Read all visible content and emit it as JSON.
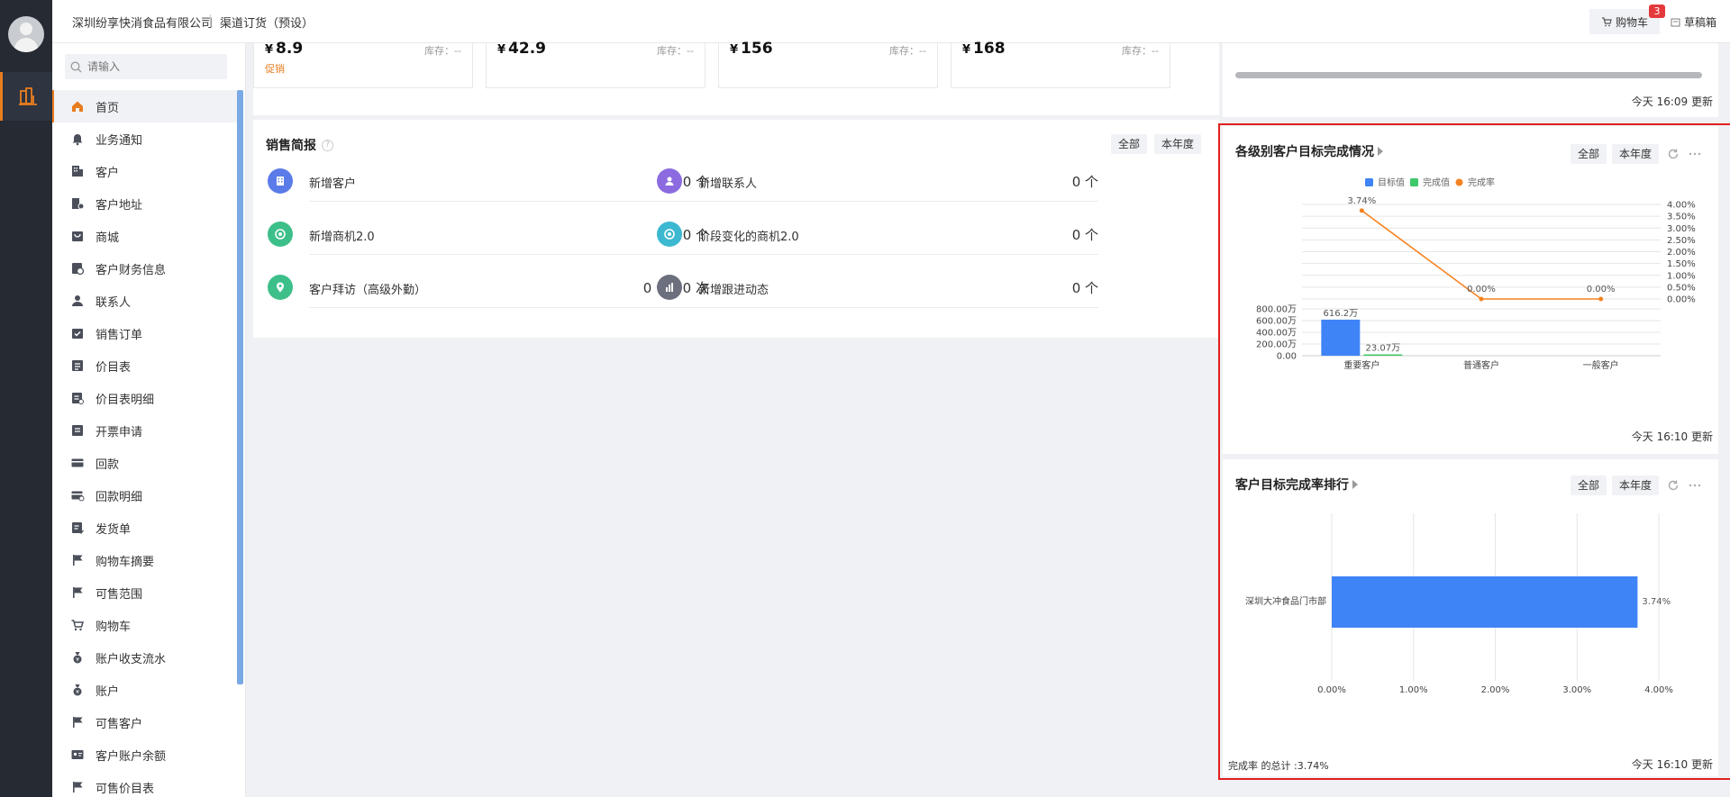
{
  "header": {
    "company": "深圳纷享快消食品有限公司",
    "channel": "渠道订货（预设）",
    "cart_label": "购物车",
    "cart_count": "3",
    "drafts_label": "草稿箱"
  },
  "search": {
    "placeholder": "请输入"
  },
  "nav": {
    "items": [
      {
        "label": "首页",
        "icon": "home-icon"
      },
      {
        "label": "业务通知",
        "icon": "bell-icon"
      },
      {
        "label": "客户",
        "icon": "building-icon"
      },
      {
        "label": "客户地址",
        "icon": "address-icon"
      },
      {
        "label": "商城",
        "icon": "store-icon"
      },
      {
        "label": "客户财务信息",
        "icon": "finance-icon"
      },
      {
        "label": "联系人",
        "icon": "person-icon"
      },
      {
        "label": "销售订单",
        "icon": "order-icon"
      },
      {
        "label": "价目表",
        "icon": "list-icon"
      },
      {
        "label": "价目表明细",
        "icon": "list-detail-icon"
      },
      {
        "label": "开票申请",
        "icon": "invoice-icon"
      },
      {
        "label": "回款",
        "icon": "card-icon"
      },
      {
        "label": "回款明细",
        "icon": "card-detail-icon"
      },
      {
        "label": "发货单",
        "icon": "delivery-icon"
      },
      {
        "label": "购物车摘要",
        "icon": "flag-icon"
      },
      {
        "label": "可售范围",
        "icon": "flag-icon"
      },
      {
        "label": "购物车",
        "icon": "cart-icon"
      },
      {
        "label": "账户收支流水",
        "icon": "money-bag-icon"
      },
      {
        "label": "账户",
        "icon": "money-bag-icon"
      },
      {
        "label": "可售客户",
        "icon": "flag-icon"
      },
      {
        "label": "客户账户余额",
        "icon": "id-card-icon"
      },
      {
        "label": "可售价目表",
        "icon": "flag-icon"
      }
    ]
  },
  "products": [
    {
      "symbol": "¥",
      "price": "8.9",
      "stock": "库存：--",
      "promo": "促销"
    },
    {
      "symbol": "¥",
      "price": "42.9",
      "stock": "库存：--",
      "promo": ""
    },
    {
      "symbol": "¥",
      "price": "156",
      "stock": "库存：--",
      "promo": ""
    },
    {
      "symbol": "¥",
      "price": "168",
      "stock": "库存：--",
      "promo": ""
    }
  ],
  "sales": {
    "title": "销售简报",
    "filter_all": "全部",
    "filter_year": "本年度",
    "rows": [
      {
        "label": "新增客户",
        "value": "0 个",
        "color": "#5b7be8"
      },
      {
        "label": "新增联系人",
        "value": "0 个",
        "color": "#8c6be0"
      },
      {
        "label": "新增商机2.0",
        "value": "0 个",
        "color": "#3dbf8a"
      },
      {
        "label": "阶段变化的商机2.0",
        "value": "0 个",
        "color": "#3cb8d0"
      },
      {
        "label": "客户拜访（高级外勤）",
        "value": "0 个  /  0 次",
        "color": "#3dbf8a"
      },
      {
        "label": "新增跟进动态",
        "value": "0 个",
        "color": "#6c6f7d"
      }
    ]
  },
  "topcard": {
    "updated": "今天 16:09 更新"
  },
  "chart1": {
    "title": "各级别客户目标完成情况",
    "filter_all": "全部",
    "filter_year": "本年度",
    "updated": "今天 16:10 更新"
  },
  "chart2": {
    "title": "客户目标完成率排行",
    "filter_all": "全部",
    "filter_year": "本年度",
    "summary": "完成率 的总计 :3.74%",
    "updated": "今天 16:10 更新"
  },
  "colors": {
    "blue": "#3f84f7",
    "green": "#3ec96a",
    "orange": "#f58220",
    "accent": "#e87d1e"
  },
  "chart_data": [
    {
      "type": "bar",
      "title": "各级别客户目标完成情况",
      "categories": [
        "重要客户",
        "普通客户",
        "一般客户"
      ],
      "series": [
        {
          "name": "目标值",
          "type": "bar",
          "values": [
            616.2,
            0,
            0
          ],
          "labels": [
            "616.2万",
            "",
            ""
          ]
        },
        {
          "name": "完成值",
          "type": "bar",
          "values": [
            23.07,
            0,
            0
          ],
          "labels": [
            "23.07万",
            "",
            ""
          ]
        },
        {
          "name": "完成率",
          "type": "line",
          "values": [
            3.74,
            0,
            0
          ],
          "labels": [
            "3.74%",
            "0.00%",
            "0.00%"
          ]
        }
      ],
      "y_left_ticks": [
        "0.00",
        "200.00万",
        "400.00万",
        "600.00万",
        "800.00万"
      ],
      "y_left_max": 800,
      "y_right_ticks": [
        "0.00%",
        "0.50%",
        "1.00%",
        "1.50%",
        "2.00%",
        "2.50%",
        "3.00%",
        "3.50%",
        "4.00%"
      ],
      "y_right_max": 4,
      "legend": "top"
    },
    {
      "type": "bar",
      "orientation": "horizontal",
      "title": "客户目标完成率排行",
      "categories": [
        "深圳大冲食品门市部"
      ],
      "values": [
        3.74
      ],
      "value_labels": [
        "3.74%"
      ],
      "x_ticks": [
        "0.00%",
        "1.00%",
        "2.00%",
        "3.00%",
        "4.00%"
      ],
      "xlim": [
        0,
        4
      ]
    }
  ]
}
